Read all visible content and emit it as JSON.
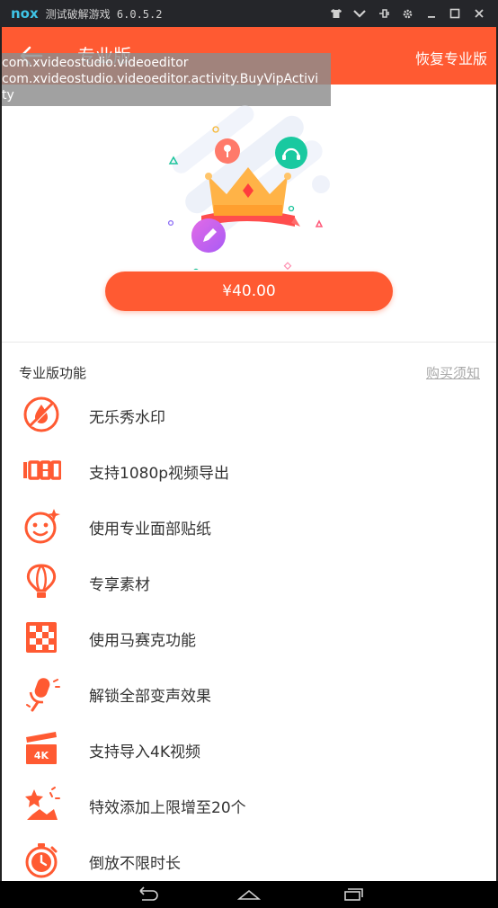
{
  "emulator": {
    "logo": "nox",
    "title": "测试破解游戏 6.0.5.2",
    "controls": [
      "shirt-icon",
      "chevron-down-icon",
      "pin-icon",
      "gear-icon",
      "minimize-icon",
      "maximize-icon",
      "close-icon"
    ]
  },
  "app_bar": {
    "title": "专业版",
    "restore_label": "恢复专业版",
    "back_icon": "back-arrow-icon"
  },
  "debug_overlay": {
    "line1": "com.xvideostudio.videoeditor",
    "line2": "com.xvideostudio.videoeditor.activity.BuyVipActivi",
    "line3": "ty"
  },
  "price_button": {
    "label": "¥40.00"
  },
  "section": {
    "title": "专业版功能",
    "notice_link": "购买须知"
  },
  "features": [
    {
      "label": "无乐秀水印",
      "icon": "no-watermark-icon"
    },
    {
      "label": "支持1080p视频导出",
      "icon": "1080p-icon"
    },
    {
      "label": "使用专业面部贴纸",
      "icon": "face-sticker-icon"
    },
    {
      "label": "专享素材",
      "icon": "hot-air-balloon-icon"
    },
    {
      "label": "使用马赛克功能",
      "icon": "mosaic-icon"
    },
    {
      "label": "解锁全部变声效果",
      "icon": "microphone-icon"
    },
    {
      "label": "支持导入4K视频",
      "icon": "4k-clapper-icon"
    },
    {
      "label": "特效添加上限增至20个",
      "icon": "effects-icon"
    },
    {
      "label": "倒放不限时长",
      "icon": "timer-icon"
    }
  ],
  "colors": {
    "accent": "#ff5a32",
    "text": "#333333",
    "muted": "#a9a9a9"
  }
}
